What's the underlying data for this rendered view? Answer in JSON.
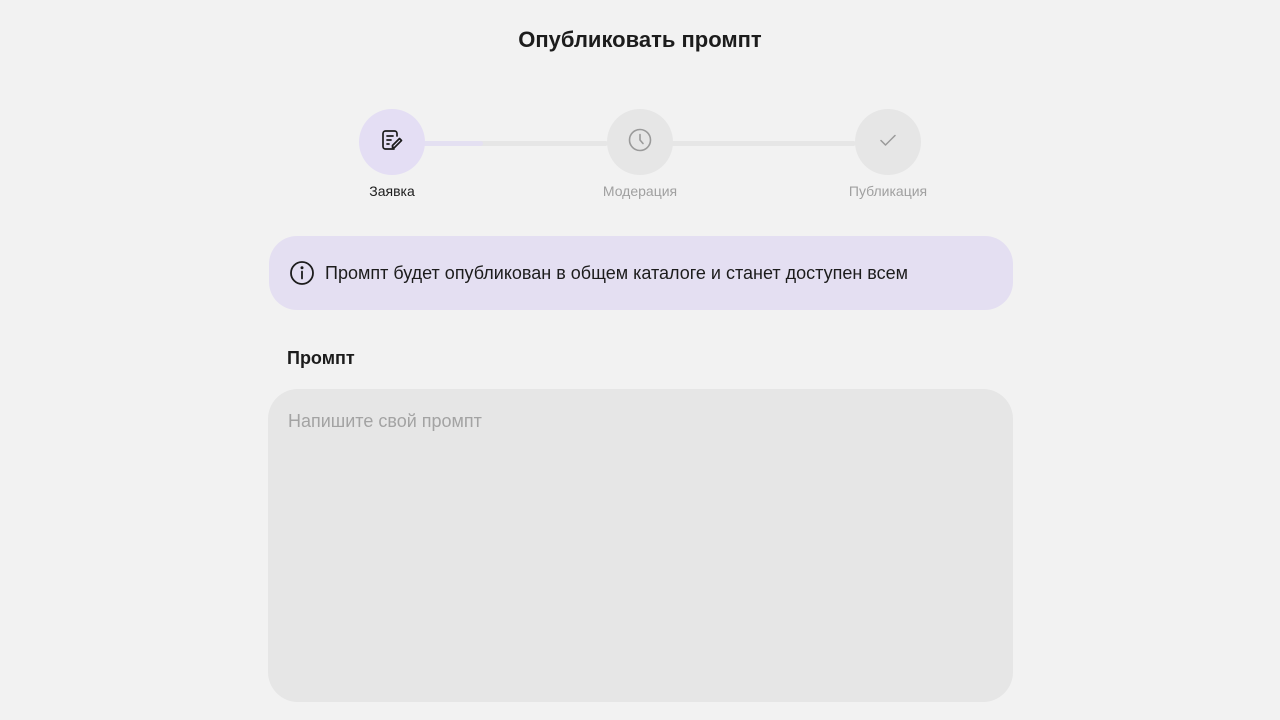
{
  "page": {
    "title": "Опубликовать промпт"
  },
  "stepper": {
    "current_step": 1,
    "progress_to_next": 0.42,
    "steps": [
      {
        "label": "Заявка",
        "icon": "edit-document-icon",
        "state": "active"
      },
      {
        "label": "Модерация",
        "icon": "clock-icon",
        "state": "pending"
      },
      {
        "label": "Публикация",
        "icon": "check-icon",
        "state": "pending"
      }
    ]
  },
  "info_banner": {
    "icon": "info-icon",
    "text": "Промпт будет опубликован в общем каталоге и станет доступен всем"
  },
  "prompt_field": {
    "label": "Промпт",
    "value": "",
    "placeholder": "Напишите свой промпт"
  },
  "colors": {
    "background": "#f2f2f2",
    "accent_light": "#e4dff2",
    "field_background": "#e6e6e6",
    "text_primary": "#1c1c1c",
    "text_muted": "#a0a0a0"
  }
}
